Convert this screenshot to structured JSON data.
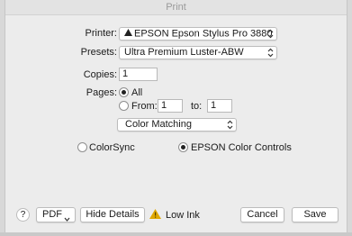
{
  "window": {
    "title": "Print"
  },
  "printer": {
    "label": "Printer:",
    "value": "EPSON Epson Stylus Pro 3880"
  },
  "presets": {
    "label": "Presets:",
    "value": "Ultra Premium Luster-ABW"
  },
  "copies": {
    "label": "Copies:",
    "value": "1"
  },
  "pages": {
    "label": "Pages:",
    "all_label": "All",
    "all_selected": true,
    "from_label": "From:",
    "from_value": "1",
    "to_label": "to:",
    "to_value": "1"
  },
  "section_menu": {
    "value": "Color Matching"
  },
  "color_options": {
    "colorsync_label": "ColorSync",
    "epson_label": "EPSON Color Controls",
    "selected": "EPSON Color Controls"
  },
  "footer": {
    "help_label": "?",
    "pdf_label": "PDF",
    "hide_details_label": "Hide Details",
    "low_ink_label": "Low Ink",
    "cancel_label": "Cancel",
    "save_label": "Save"
  },
  "icons": {
    "printer_status": "warning-triangle-icon",
    "low_ink": "warning-triangle-icon",
    "popup_arrows": "chevron-up-down-icon",
    "pdf_arrow": "chevron-down-icon"
  },
  "colors": {
    "warning": "#e0a800",
    "dialog_bg": "#ececec"
  }
}
